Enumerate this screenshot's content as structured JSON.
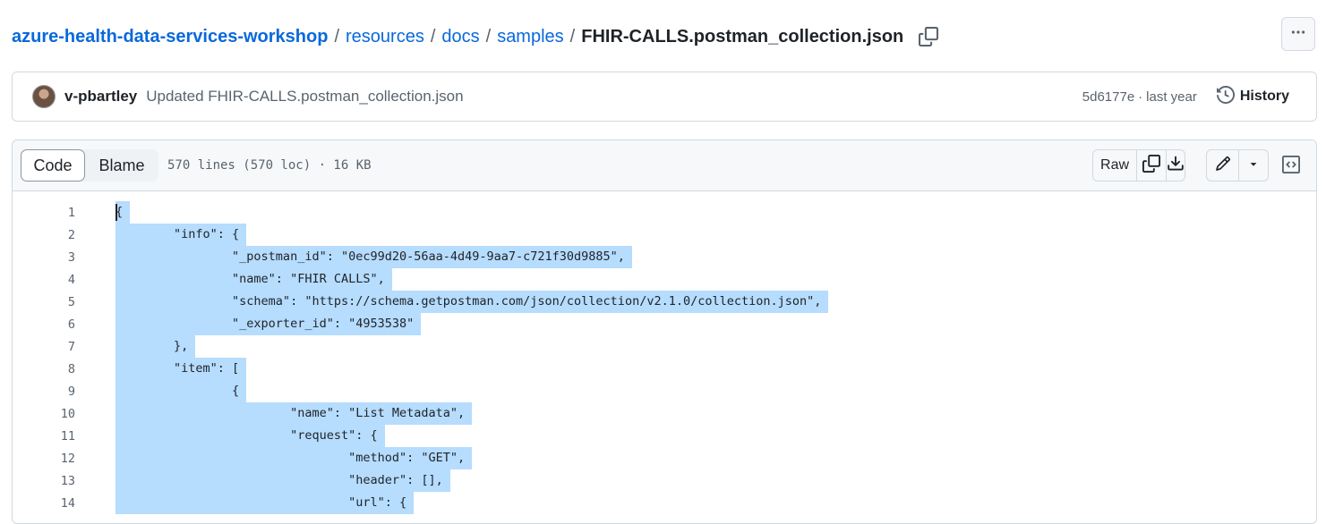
{
  "breadcrumb": {
    "repo": "azure-health-data-services-workshop",
    "parts": [
      "resources",
      "docs",
      "samples"
    ],
    "separator": "/",
    "file": "FHIR-CALLS.postman_collection.json"
  },
  "commit": {
    "author": "v-pbartley",
    "message": "Updated FHIR-CALLS.postman_collection.json",
    "sha": "5d6177e",
    "dot": "·",
    "time": "last year",
    "history_label": "History"
  },
  "file_header": {
    "tabs": [
      {
        "label": "Code",
        "active": true
      },
      {
        "label": "Blame",
        "active": false
      }
    ],
    "meta": "570 lines (570 loc) · 16 KB",
    "raw_label": "Raw"
  },
  "icons": {
    "copy": "copy-icon",
    "more": "kebab-horizontal-icon",
    "history": "history-icon",
    "download": "download-icon",
    "edit": "pencil-icon",
    "dropdown": "triangle-down-icon",
    "symbols": "code-square-icon"
  },
  "colors": {
    "link": "#0969da",
    "selection": "#b6dcfe",
    "muted": "#59636e",
    "border": "#d1d9e0"
  },
  "code_lines": [
    {
      "n": "1",
      "text": "{"
    },
    {
      "n": "2",
      "text": "\t\"info\": {"
    },
    {
      "n": "3",
      "text": "\t\t\"_postman_id\": \"0ec99d20-56aa-4d49-9aa7-c721f30d9885\","
    },
    {
      "n": "4",
      "text": "\t\t\"name\": \"FHIR CALLS\","
    },
    {
      "n": "5",
      "text": "\t\t\"schema\": \"https://schema.getpostman.com/json/collection/v2.1.0/collection.json\","
    },
    {
      "n": "6",
      "text": "\t\t\"_exporter_id\": \"4953538\""
    },
    {
      "n": "7",
      "text": "\t},"
    },
    {
      "n": "8",
      "text": "\t\"item\": ["
    },
    {
      "n": "9",
      "text": "\t\t{"
    },
    {
      "n": "10",
      "text": "\t\t\t\"name\": \"List Metadata\","
    },
    {
      "n": "11",
      "text": "\t\t\t\"request\": {"
    },
    {
      "n": "12",
      "text": "\t\t\t\t\"method\": \"GET\","
    },
    {
      "n": "13",
      "text": "\t\t\t\t\"header\": [],"
    },
    {
      "n": "14",
      "text": "\t\t\t\t\"url\": {"
    }
  ]
}
